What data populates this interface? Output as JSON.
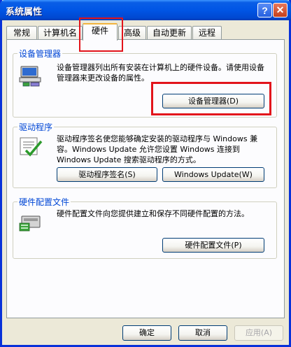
{
  "window": {
    "title": "系统属性",
    "help_glyph": "?",
    "close_glyph": "✕"
  },
  "tabs": [
    {
      "label": "常规"
    },
    {
      "label": "计算机名"
    },
    {
      "label": "硬件"
    },
    {
      "label": "高级"
    },
    {
      "label": "自动更新"
    },
    {
      "label": "远程"
    }
  ],
  "groups": {
    "device_manager": {
      "label": "设备管理器",
      "description": "设备管理器列出所有安装在计算机上的硬件设备。请使用设备管理器来更改设备的属性。",
      "button": "设备管理器(D)",
      "icon": "device-manager-icon"
    },
    "drivers": {
      "label": "驱动程序",
      "description": "驱动程序签名使您能够确定安装的驱动程序与 Windows 兼容。Windows Update 允许您设置 Windows 连接到 Windows Update 搜索驱动程序的方式。",
      "button_signing": "驱动程序签名(S)",
      "button_update": "Windows Update(W)",
      "icon": "driver-signing-icon"
    },
    "hardware_profiles": {
      "label": "硬件配置文件",
      "description": "硬件配置文件向您提供建立和保存不同硬件配置的方法。",
      "button": "硬件配置文件(P)",
      "icon": "hardware-profile-icon"
    }
  },
  "footer": {
    "ok": "确定",
    "cancel": "取消",
    "apply": "应用(A)"
  },
  "colors": {
    "titlebar": "#0055e5",
    "group_label": "#0046d5",
    "highlight": "#e2141b"
  }
}
